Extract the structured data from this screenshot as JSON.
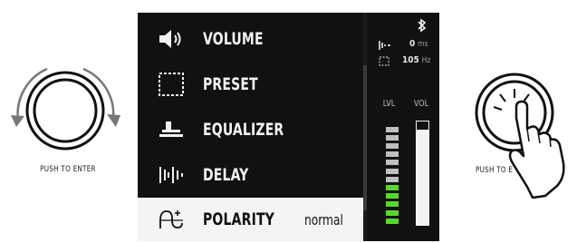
{
  "left_knob": {
    "caption": "PUSH TO ENTER"
  },
  "right_knob": {
    "caption": "PUSH TO E"
  },
  "menu": {
    "items": [
      {
        "label": "VOLUME",
        "icon": "speaker-icon"
      },
      {
        "label": "PRESET",
        "icon": "dashed-square-icon"
      },
      {
        "label": "EQUALIZER",
        "icon": "equalizer-icon"
      },
      {
        "label": "DELAY",
        "icon": "delay-icon"
      },
      {
        "label": "POLARITY",
        "icon": "polarity-icon",
        "value": "normal",
        "selected": true
      }
    ]
  },
  "status": {
    "delay_value": "0",
    "delay_unit": "ms",
    "crossover_value": "105",
    "crossover_unit": "Hz",
    "lvl_label": "LVL",
    "vol_label": "VOL",
    "lvl_segments_total": 12,
    "lvl_segments_green": 5,
    "vol_level": 0.92
  },
  "colors": {
    "screen_bg": "#111111",
    "meter_green": "#5bd62f",
    "meter_gray": "#bfbfbf",
    "highlight_bg": "#f4f4f4"
  }
}
